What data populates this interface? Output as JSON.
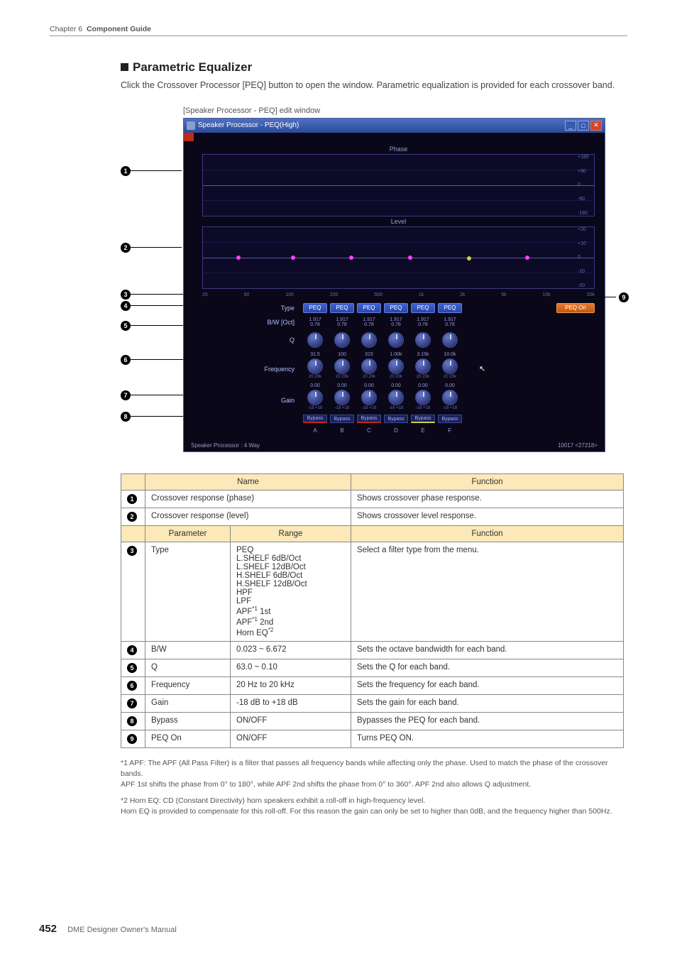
{
  "header": {
    "chapter": "Chapter 6",
    "title": "Component Guide"
  },
  "section": {
    "heading": "Parametric Equalizer",
    "lead": "Click the Crossover Processor [PEQ] button to open the window. Parametric equalization is provided for each crossover band.",
    "caption": "[Speaker Processor - PEQ] edit window"
  },
  "shot": {
    "title": "Speaker Processor - PEQ(High)",
    "phase_label": "Phase",
    "level_label": "Level",
    "yaxis_phase": [
      "+180",
      "+90",
      "0",
      "-90",
      "-180"
    ],
    "yaxis_level": [
      "+20",
      "+10",
      "0",
      "-10",
      "-20"
    ],
    "xaxis": [
      "20",
      "50",
      "100",
      "200",
      "500",
      "1k",
      "2k",
      "5k",
      "10k",
      "20k"
    ],
    "row_labels": {
      "type": "Type",
      "bw": "B/W [Oct]",
      "q": "Q",
      "freq": "Frequency",
      "gain": "Gain"
    },
    "peq_btn": "PEQ",
    "bw_top": "1.917",
    "bw_bot": "0.78",
    "freq_vals": [
      "31.5",
      "100",
      "315",
      "1.00k",
      "3.15k",
      "10.0k"
    ],
    "freq_sub": "20  20k",
    "gain_val": "0.00",
    "gain_sub": "-18  +18",
    "bypass": "Bypass",
    "band_lbls": [
      "A",
      "B",
      "C",
      "D",
      "E",
      "F"
    ],
    "peq_on": "PEQ On",
    "status_left": "Speaker Processor : 4 Way",
    "status_right": "10017 <27218>"
  },
  "table": {
    "head_name": "Name",
    "head_function": "Function",
    "head_param": "Parameter",
    "head_range": "Range",
    "rows12": [
      {
        "n": "1",
        "name": "Crossover response (phase)",
        "fn": "Shows crossover phase response."
      },
      {
        "n": "2",
        "name": "Crossover response (level)",
        "fn": "Shows crossover level response."
      }
    ],
    "rows38": [
      {
        "n": "3",
        "param": "Type",
        "range": "PEQ\nL.SHELF 6dB/Oct\nL.SHELF 12dB/Oct\nH.SHELF 6dB/Oct\nH.SHELF 12dB/Oct\nHPF\nLPF\nAPF*1 1st\nAPF*1 2nd\nHorn EQ*2",
        "fn": "Select a filter type from the menu."
      },
      {
        "n": "4",
        "param": "B/W",
        "range": "0.023 ~ 6.672",
        "fn": "Sets the octave bandwidth for each band."
      },
      {
        "n": "5",
        "param": "Q",
        "range": "63.0 ~ 0.10",
        "fn": "Sets the Q for each band."
      },
      {
        "n": "6",
        "param": "Frequency",
        "range": "20 Hz to 20 kHz",
        "fn": "Sets the frequency for each band."
      },
      {
        "n": "7",
        "param": "Gain",
        "range": "-18 dB to +18 dB",
        "fn": "Sets the gain for each band."
      },
      {
        "n": "8",
        "param": "Bypass",
        "range": "ON/OFF",
        "fn": "Bypasses the PEQ for each band."
      },
      {
        "n": "9",
        "param": "PEQ On",
        "range": "ON/OFF",
        "fn": "Turns PEQ ON."
      }
    ]
  },
  "footnotes": {
    "f1a": "*1 APF: The APF (All Pass Filter) is a filter that passes all frequency bands while affecting only the phase. Used to match the phase of the crossover bands.",
    "f1b": "APF 1st shifts the phase from 0° to 180°, while APF 2nd shifts the phase from 0° to 360°. APF 2nd also allows Q adjustment.",
    "f2a": "*2 Horn EQ: CD (Constant Directivity) horn speakers exhibit a roll-off in high-frequency level.",
    "f2b": "Horn EQ is provided to compensate for this roll-off. For this reason the gain can only be set to higher than 0dB, and the frequency higher than 500Hz."
  },
  "footer": {
    "page": "452",
    "doc": "DME Designer Owner's Manual"
  }
}
